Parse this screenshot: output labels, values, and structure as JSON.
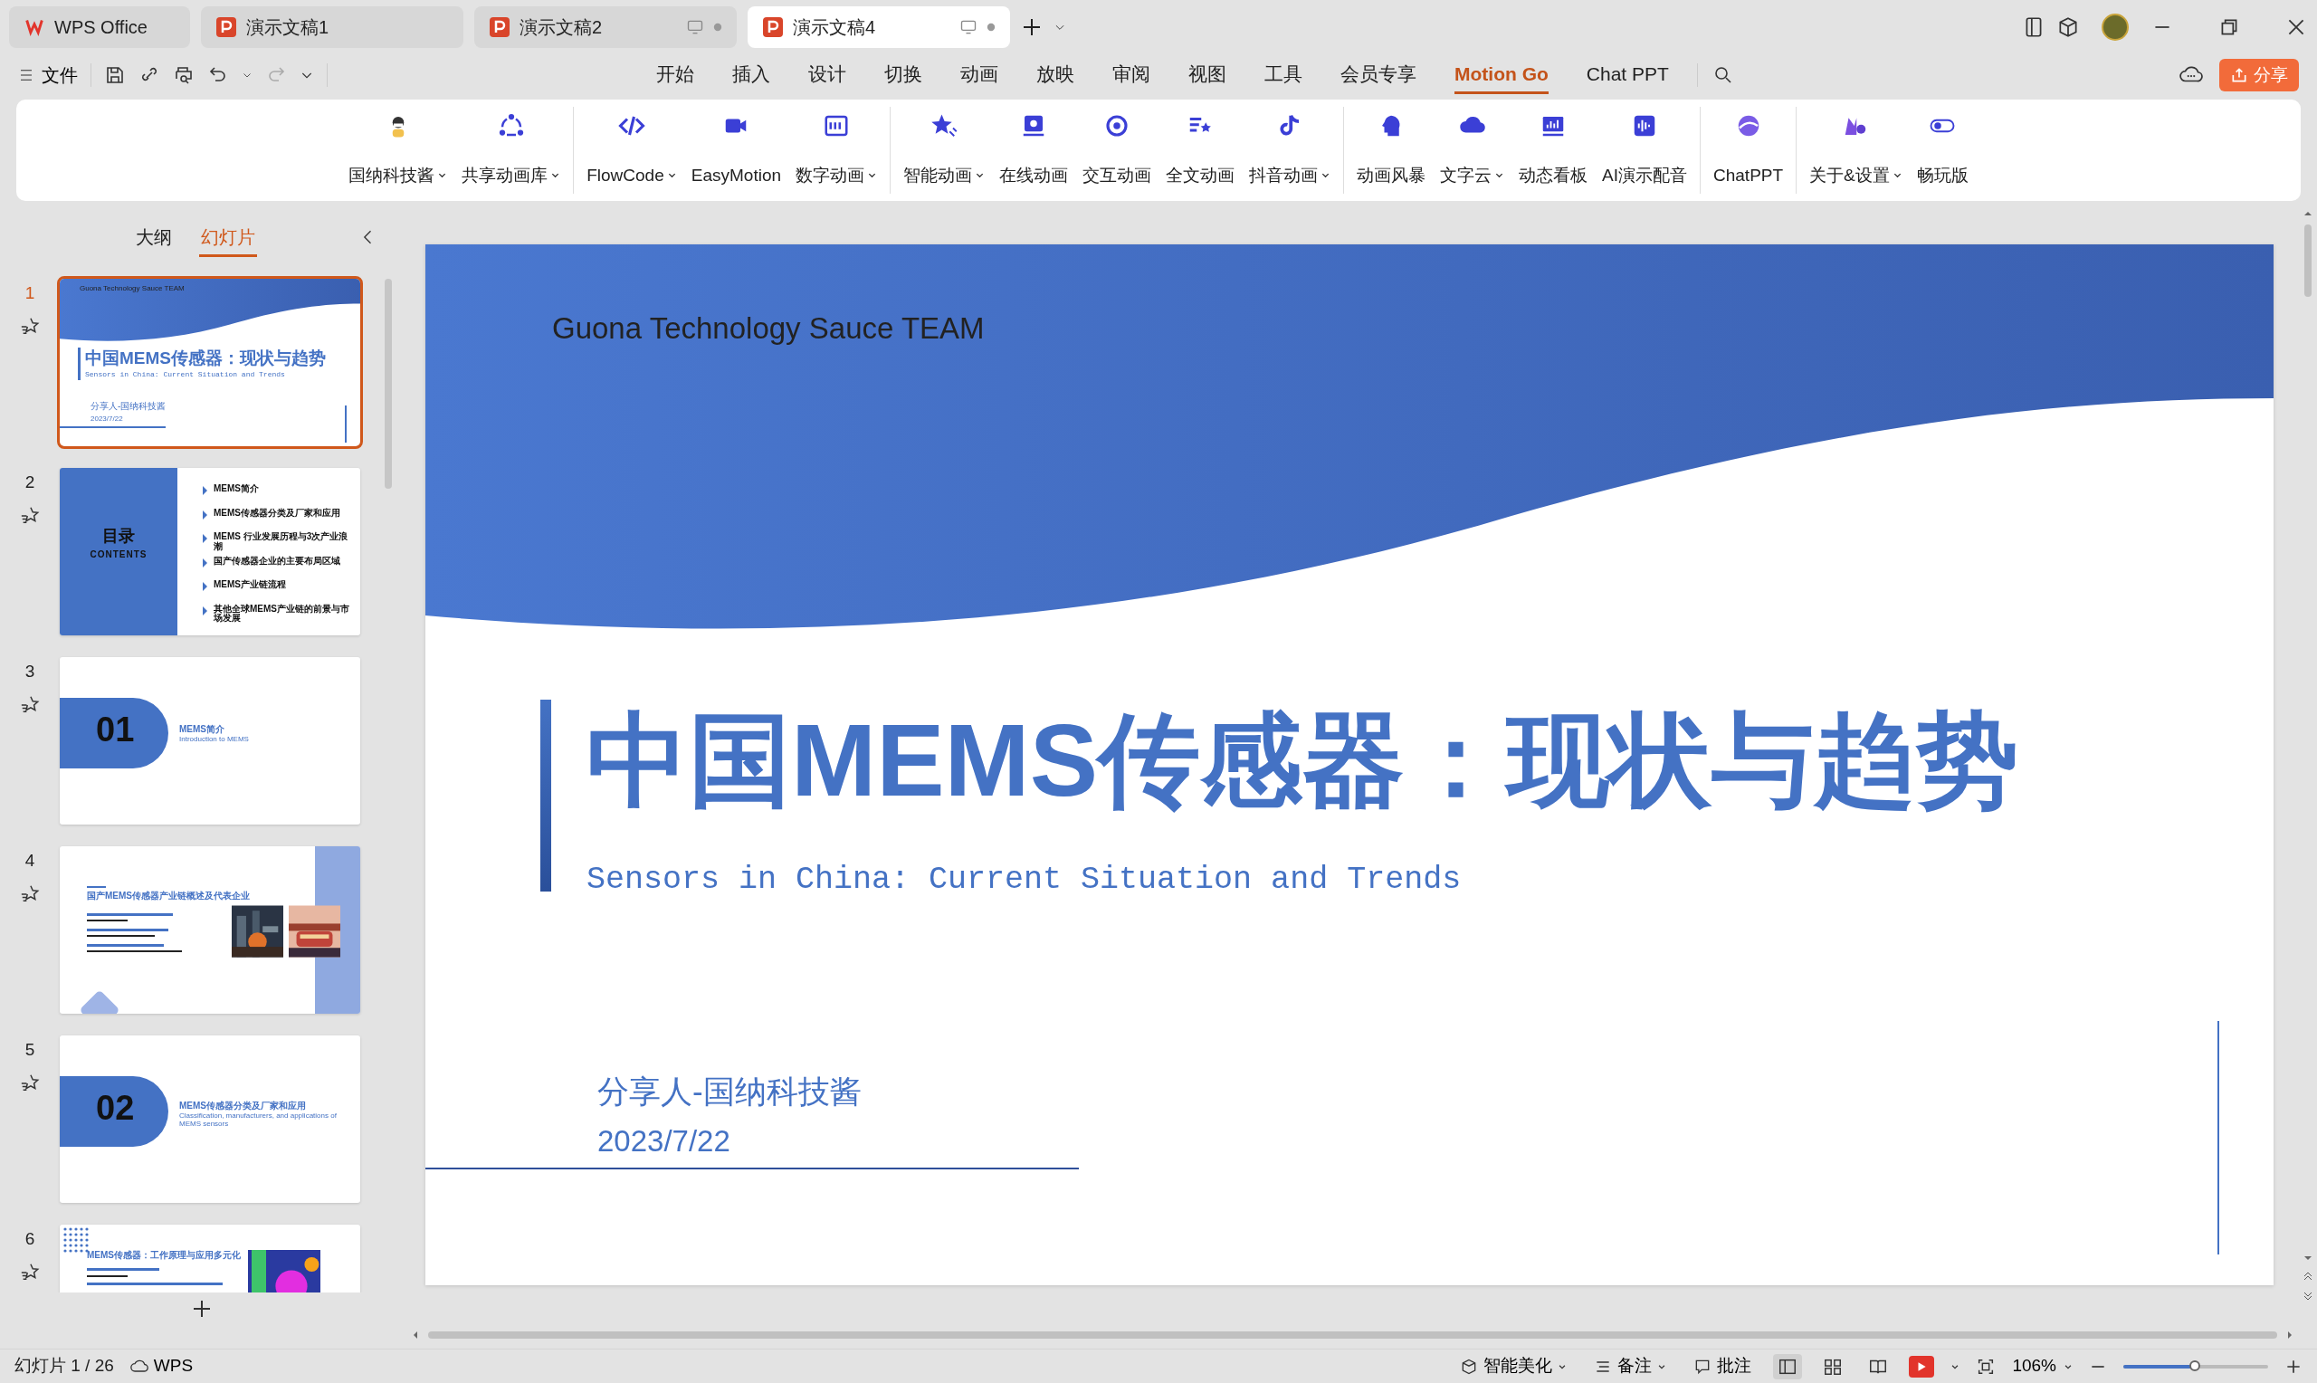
{
  "app_tabs": [
    {
      "label": "WPS Office",
      "kind": "home",
      "selected": false
    },
    {
      "label": "演示文稿1",
      "kind": "document",
      "selected": false
    },
    {
      "label": "演示文稿2",
      "kind": "document-status",
      "selected": false
    },
    {
      "label": "演示文稿4",
      "kind": "document-status",
      "selected": true
    }
  ],
  "file_menu": {
    "label": "文件"
  },
  "menu_tabs": [
    {
      "label": "开始",
      "selected": false
    },
    {
      "label": "插入",
      "selected": false
    },
    {
      "label": "设计",
      "selected": false
    },
    {
      "label": "切换",
      "selected": false
    },
    {
      "label": "动画",
      "selected": false
    },
    {
      "label": "放映",
      "selected": false
    },
    {
      "label": "审阅",
      "selected": false
    },
    {
      "label": "视图",
      "selected": false
    },
    {
      "label": "工具",
      "selected": false
    },
    {
      "label": "会员专享",
      "selected": false
    },
    {
      "label": "Motion Go",
      "selected": true
    },
    {
      "label": "Chat PPT",
      "selected": false
    }
  ],
  "share_button": {
    "label": "分享"
  },
  "ribbon_groups": [
    {
      "items": [
        {
          "label": "国纳科技酱",
          "dropdown": true
        },
        {
          "label": "共享动画库",
          "dropdown": true
        }
      ]
    },
    {
      "items": [
        {
          "label": "FlowCode",
          "dropdown": true
        },
        {
          "label": "EasyMotion",
          "dropdown": false
        },
        {
          "label": "数字动画",
          "dropdown": true
        }
      ]
    },
    {
      "items": [
        {
          "label": "智能动画",
          "dropdown": true
        },
        {
          "label": "在线动画",
          "dropdown": false
        },
        {
          "label": "交互动画",
          "dropdown": false
        },
        {
          "label": "全文动画",
          "dropdown": false
        },
        {
          "label": "抖音动画",
          "dropdown": true
        }
      ]
    },
    {
      "items": [
        {
          "label": "动画风暴",
          "dropdown": false
        },
        {
          "label": "文字云",
          "dropdown": true
        },
        {
          "label": "动态看板",
          "dropdown": false
        },
        {
          "label": "AI演示配音",
          "dropdown": false
        }
      ]
    },
    {
      "items": [
        {
          "label": "ChatPPT",
          "dropdown": false
        }
      ]
    },
    {
      "items": [
        {
          "label": "关于&设置",
          "dropdown": true
        },
        {
          "label": "畅玩版",
          "dropdown": false
        }
      ]
    }
  ],
  "panel_tabs": [
    {
      "label": "大纲",
      "selected": false
    },
    {
      "label": "幻灯片",
      "selected": true
    }
  ],
  "slides": [
    {
      "number": "1",
      "selected": true,
      "kind": "title",
      "team": "Guona Technology Sauce TEAM",
      "title": "中国MEMS传感器：现状与趋势",
      "subtitle": "Sensors in China: Current Situation and Trends",
      "presenter": "分享人-国纳科技酱",
      "date": "2023/7/22"
    },
    {
      "number": "2",
      "selected": false,
      "kind": "contents",
      "heading": "目录",
      "heading_en": "CONTENTS",
      "items": [
        "MEMS简介",
        "MEMS传感器分类及厂家和应用",
        "MEMS 行业发展历程与3次产业浪潮",
        "国产传感器企业的主要布局区域",
        "MEMS产业链流程",
        "其他全球MEMS产业链的前景与市场发展"
      ]
    },
    {
      "number": "3",
      "selected": false,
      "kind": "section",
      "index": "01",
      "title": "MEMS简介",
      "subtitle": "Introduction to MEMS"
    },
    {
      "number": "4",
      "selected": false,
      "kind": "overview",
      "title": "国产MEMS传感器产业链概述及代表企业"
    },
    {
      "number": "5",
      "selected": false,
      "kind": "section",
      "index": "02",
      "title": "MEMS传感器分类及厂家和应用",
      "subtitle": "Classification, manufacturers, and applications of MEMS sensors"
    },
    {
      "number": "6",
      "selected": false,
      "kind": "feature",
      "title": "MEMS传感器：工作原理与应用多元化"
    }
  ],
  "current_slide": {
    "team": "Guona Technology Sauce TEAM",
    "title": "中国MEMS传感器：现状与趋势",
    "subtitle": "Sensors in China: Current Situation and Trends",
    "presenter": "分享人-国纳科技酱",
    "date": "2023/7/22"
  },
  "status_bar": {
    "slide_counter": "幻灯片 1 / 26",
    "wps_label": "WPS",
    "beautify": "智能美化",
    "notes": "备注",
    "comments": "批注",
    "views": [
      {
        "selected": true
      },
      {
        "selected": false
      },
      {
        "selected": false
      }
    ],
    "zoom": "106%",
    "zoom_slider": {
      "level": 0.5
    }
  }
}
